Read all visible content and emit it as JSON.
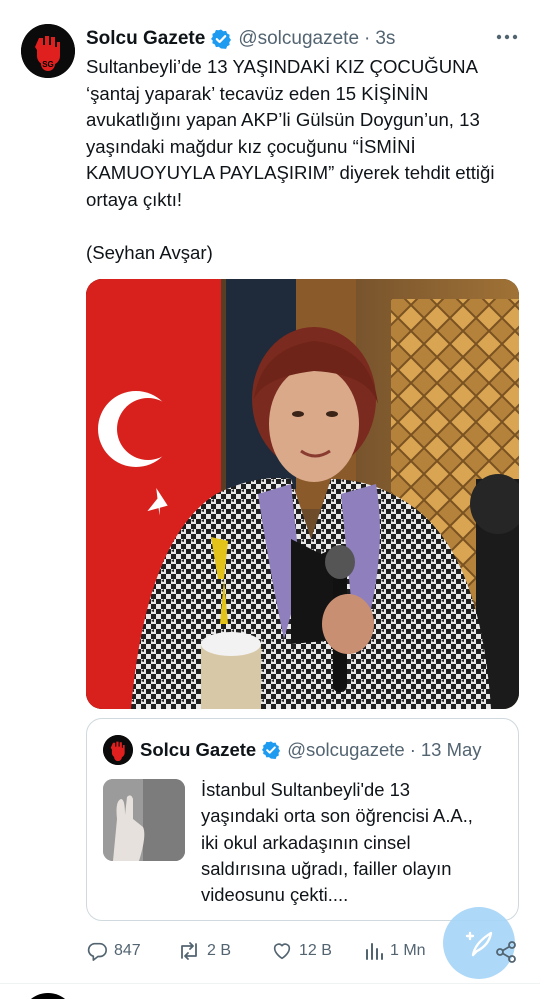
{
  "tweet": {
    "display_name": "Solcu Gazete",
    "handle": "@solcugazete",
    "separator": "·",
    "time": "3s",
    "avatar_text": "SG",
    "body_lines": [
      "Sultanbeyli’de 13 YAŞINDAKİ KIZ ÇOCUĞUNA",
      "‘şantaj yaparak’ tecavüz eden 15 KİŞİNİN",
      "avukatlığını yapan AKP’li Gülsün Doygun’un, 13",
      "yaşındaki mağdur kız çocuğunu “İSMİNİ",
      "KAMUOYUYLA PAYLAŞIRIM” diyerek tehdit ettiği",
      "ortaya çıktı!"
    ],
    "credit": "(Seyhan Avşar)",
    "colors": {
      "verified": "#1d9bf0",
      "text": "#0f1419",
      "secondary": "#536471",
      "fab": "#a9d6f7"
    }
  },
  "quote": {
    "display_name": "Solcu Gazete",
    "handle": "@solcugazete",
    "separator": "·",
    "date": "13 May",
    "text_lines": [
      "İstanbul Sultanbeyli'de 13",
      "yaşındaki orta son öğrencisi A.A.,",
      "iki okul arkadaşının cinsel",
      "saldırısına uğradı, failler olayın",
      "videosunu çekti...."
    ]
  },
  "actions": {
    "replies": "847",
    "reposts": "2 B",
    "likes": "12 B",
    "views": "1 Mn"
  }
}
